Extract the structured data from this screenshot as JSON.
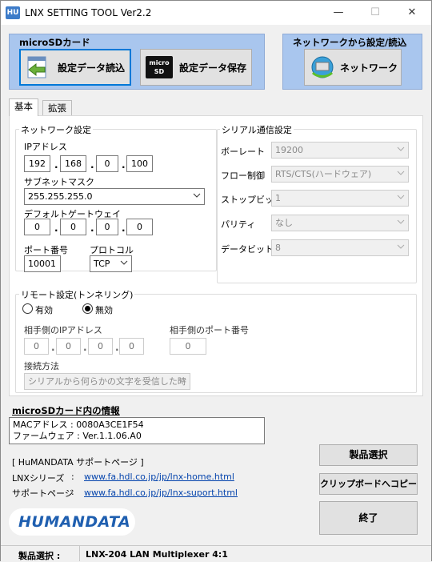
{
  "window": {
    "title": "LNX SETTING TOOL Ver2.2",
    "app_icon_text": "HU",
    "minimize": "—",
    "maximize": "☐",
    "close": "✕"
  },
  "sd_group": {
    "title": "microSDカード",
    "load_label": "設定データ読込",
    "save_label": "設定データ保存",
    "sd_icon_text": "micro SD"
  },
  "net_group": {
    "title": "ネットワークから設定/読込",
    "network_label": "ネットワーク"
  },
  "tabs": [
    {
      "label": "基本"
    },
    {
      "label": "拡張"
    }
  ],
  "network": {
    "legend": "ネットワーク設定",
    "ip_label": "IPアドレス",
    "ip": [
      "192",
      "168",
      "0",
      "100"
    ],
    "subnet_label": "サブネットマスク",
    "subnet_value": "255.255.255.0",
    "gateway_label": "デフォルトゲートウェイ",
    "gateway": [
      "0",
      "0",
      "0",
      "0"
    ],
    "port_label": "ポート番号",
    "port_value": "10001",
    "protocol_label": "プロトコル",
    "protocol_value": "TCP"
  },
  "serial": {
    "legend": "シリアル通信設定",
    "rows": [
      {
        "label": "ボーレート",
        "value": "19200"
      },
      {
        "label": "フロー制御",
        "value": "RTS/CTS(ハードウェア)"
      },
      {
        "label": "ストップビット",
        "value": "1"
      },
      {
        "label": "パリティ",
        "value": "なし"
      },
      {
        "label": "データビット",
        "value": "8"
      }
    ]
  },
  "remote": {
    "legend": "リモート設定(トンネリング)",
    "enable_label": "有効",
    "disable_label": "無効",
    "selected": "無効",
    "peer_ip_label": "相手側のIPアドレス",
    "peer_ip": [
      "0",
      "0",
      "0",
      "0"
    ],
    "peer_port_label": "相手側のポート番号",
    "peer_port": "0",
    "method_label": "接続方法",
    "method_value": "シリアルから何らかの文字を受信した時"
  },
  "sdinfo": {
    "title": "microSDカード内の情報",
    "mac_line": "MACアドレス : 0080A3CE1F54",
    "fw_line": "ファームウェア : Ver.1.1.06.A0"
  },
  "support": {
    "heading": "[ HuMANDATA サポートページ ]",
    "lnx_label": "LNXシリーズ",
    "lnx_colon": ":",
    "lnx_url": "www.fa.hdl.co.jp/jp/lnx-home.html",
    "sup_label": "サポートページ",
    "sup_colon": ":",
    "sup_url": "www.fa.hdl.co.jp/jp/lnx-suport.html"
  },
  "buttons": {
    "product_select": "製品選択",
    "copy_clipboard": "クリップボードへコピー",
    "exit": "終了"
  },
  "logo_text": "HUMANDATA",
  "statusbar": {
    "label": "製品選択 :",
    "value": "LNX-204 LAN Multiplexer 4:1"
  },
  "colors": {
    "accent": "#0078d7",
    "group_blue": "#a9c6ee",
    "link": "#0645ad",
    "logo": "#1f5fb0"
  }
}
